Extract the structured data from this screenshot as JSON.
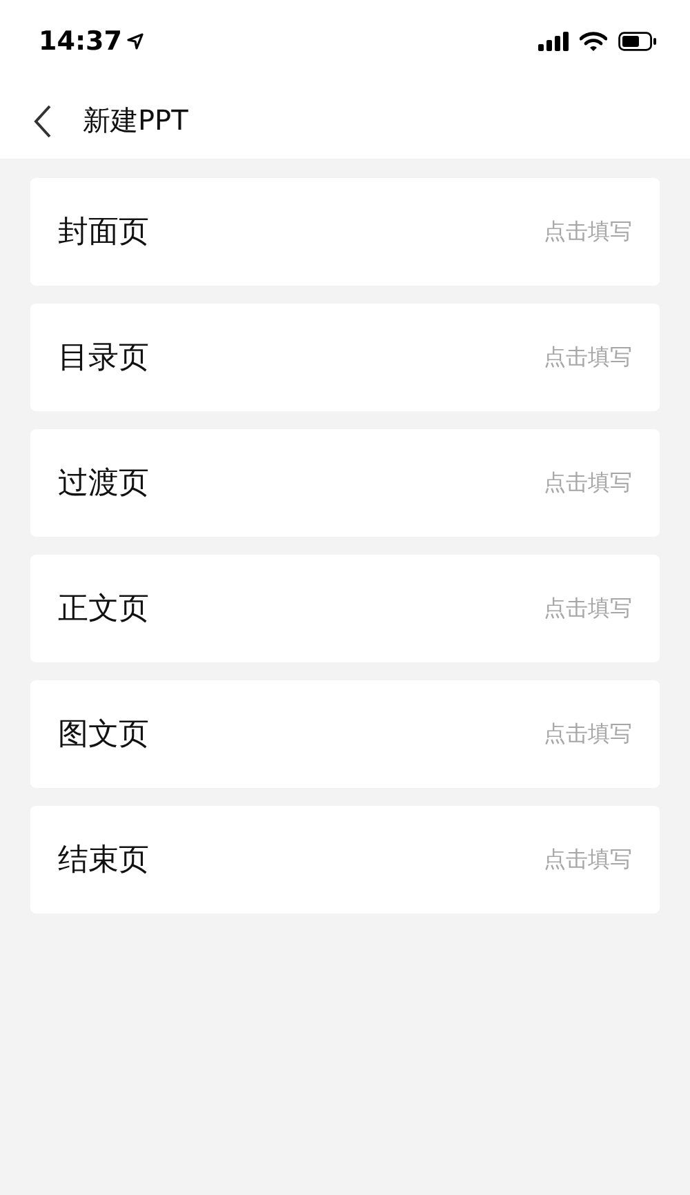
{
  "status_bar": {
    "time": "14:37"
  },
  "header": {
    "title": "新建PPT"
  },
  "items": [
    {
      "label": "封面页",
      "hint": "点击填写"
    },
    {
      "label": "目录页",
      "hint": "点击填写"
    },
    {
      "label": "过渡页",
      "hint": "点击填写"
    },
    {
      "label": "正文页",
      "hint": "点击填写"
    },
    {
      "label": "图文页",
      "hint": "点击填写"
    },
    {
      "label": "结束页",
      "hint": "点击填写"
    }
  ]
}
